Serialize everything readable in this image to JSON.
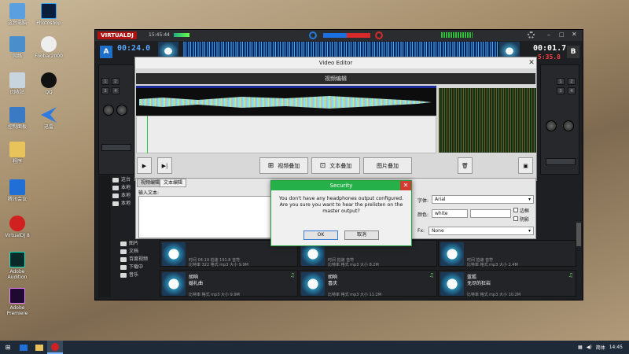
{
  "desktop": {
    "icons": [
      {
        "label": "这台电脑"
      },
      {
        "label": "Photoshop"
      },
      {
        "label": "网络"
      },
      {
        "label": "Foobar2000"
      },
      {
        "label": "回收站"
      },
      {
        "label": "QQ"
      },
      {
        "label": "控制面板"
      },
      {
        "label": "迅雷"
      },
      {
        "label": "程序"
      },
      {
        "label": "腾讯会议"
      },
      {
        "label": "VirtualDJ 8"
      },
      {
        "label": "Adobe Audition"
      },
      {
        "label": "Adobe Premiere"
      }
    ]
  },
  "vdj": {
    "logo": "VIRTUALDJ",
    "clock": "15:45:44",
    "deck_a": {
      "label": "A",
      "time": "00:24.0"
    },
    "deck_b": {
      "label": "B",
      "time": "00:01.7",
      "remain": "5:35.8"
    }
  },
  "video_editor": {
    "title": "Video Editor",
    "subtitle": "视频编辑",
    "play_icon": "play-icon",
    "next_icon": "skip-next-icon",
    "buttons": {
      "video_overlay": "视频叠加",
      "text_overlay": "文本叠加",
      "image_overlay": "图片叠加"
    }
  },
  "text_panel": {
    "tabs": [
      "视频编辑",
      "文本编辑"
    ],
    "input_label": "输入文本:",
    "font_label": "字体:",
    "font_value": "Arial",
    "color_label": "颜色:",
    "color_value": "white",
    "border_label": "边框",
    "shadow_label": "阴影",
    "fx_label": "Fx:",
    "fx_value": "None"
  },
  "security_dialog": {
    "title": "Security",
    "message": "You don't have any headphones output configured. Are you sure you want to hear the prelisten on the master output?",
    "ok": "OK",
    "cancel": "取消"
  },
  "browser": {
    "tree": [
      "这台",
      "本地",
      "本地",
      "本地",
      "图片",
      "文档",
      "百度视频",
      "下载中",
      "音乐"
    ],
    "tracks": [
      {
        "title": "",
        "artist": "",
        "meta1": "时间 04:19  拍速 191.8  音符",
        "meta2": "比特率 322  格式 mp3  大小 9.9M"
      },
      {
        "title": "",
        "artist": "",
        "meta1": "时间  拍速  音符",
        "meta2": "比特率  格式 mp3  大小 8.2M"
      },
      {
        "title": "",
        "artist": "",
        "meta1": "时间  拍速  音符",
        "meta2": "比特率  格式 mp3  大小 2.4M"
      },
      {
        "title": "胡响",
        "artist": "婚礼曲",
        "meta1": "时间  拍速  音符",
        "meta2": "比特率  格式 mp3  大小 9.9M"
      },
      {
        "title": "胡响",
        "artist": "喜庆",
        "meta1": "时间  拍速  音符",
        "meta2": "比特率  格式 mp3  大小 11.2M"
      },
      {
        "title": "蓝狐",
        "artist": "无尽的狂岩",
        "meta1": "时间  拍速  音符",
        "meta2": "比特率  格式 mp3  大小 10.2M"
      }
    ],
    "right_size": "12.3M"
  },
  "taskbar": {
    "ime": "简体",
    "time": "14:45"
  },
  "colors": {
    "accent_green": "#26b04a",
    "vdj_red": "#b01212",
    "deck_blue": "#1e6fc9"
  }
}
